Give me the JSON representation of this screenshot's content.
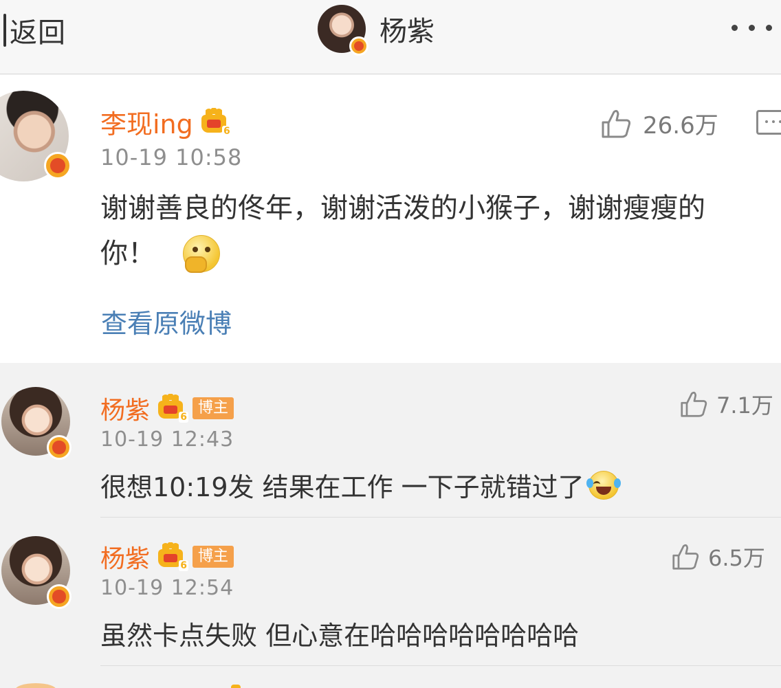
{
  "nav": {
    "back_label": "返回",
    "title": "杨紫",
    "more_icon": "more-dots-icon"
  },
  "post": {
    "author": "李现ing",
    "level": "6",
    "time": "10-19 10:58",
    "text_line1": "谢谢善良的佟年，谢谢活泼的小猴子，谢谢瘦瘦的",
    "text_line2": "你！",
    "view_origin": "查看原微博",
    "likes": "26.6万"
  },
  "comments": [
    {
      "author": "杨紫",
      "level": "6",
      "badge": "博主",
      "time": "10-19 12:43",
      "text": "很想10:19发 结果在工作 一下子就错过了",
      "likes": "7.1万"
    },
    {
      "author": "杨紫",
      "level": "6",
      "badge": "博主",
      "time": "10-19 12:54",
      "text": "虽然卡点失败 但心意在哈哈哈哈哈哈哈哈",
      "likes": "6.5万"
    }
  ],
  "colors": {
    "name": "#f26d21",
    "link": "#4a7fb5",
    "meta": "#8e8e8e",
    "badge": "#f5a04a"
  }
}
